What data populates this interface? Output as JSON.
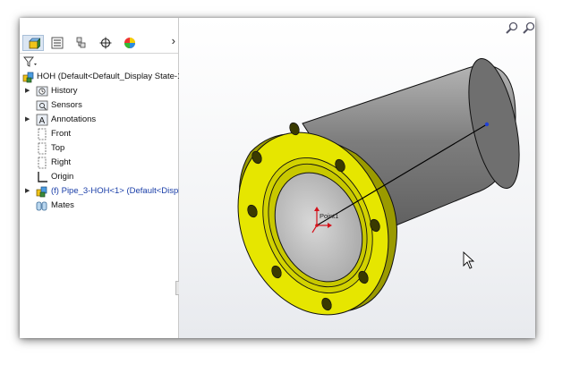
{
  "tabs": [
    {
      "icon": "feature-manager-icon",
      "active": true
    },
    {
      "icon": "property-manager-icon",
      "active": false
    },
    {
      "icon": "configuration-manager-icon",
      "active": false
    },
    {
      "icon": "dimxpert-manager-icon",
      "active": false
    },
    {
      "icon": "display-manager-icon",
      "active": false
    }
  ],
  "tabs_more": "›",
  "tree": {
    "root": "HOH  (Default<Default_Display State-1>",
    "items": [
      {
        "label": "History",
        "icon": "history-icon",
        "expandable": true
      },
      {
        "label": "Sensors",
        "icon": "sensors-icon",
        "expandable": false
      },
      {
        "label": "Annotations",
        "icon": "annotations-icon",
        "expandable": true
      },
      {
        "label": "Front",
        "icon": "plane-icon",
        "expandable": false
      },
      {
        "label": "Top",
        "icon": "plane-icon",
        "expandable": false
      },
      {
        "label": "Right",
        "icon": "plane-icon",
        "expandable": false
      },
      {
        "label": "Origin",
        "icon": "origin-icon",
        "expandable": false
      },
      {
        "label": "(f) Pipe_3-HOH<1> (Default<Display",
        "icon": "part-icon",
        "expandable": true,
        "highlight": true
      },
      {
        "label": "Mates",
        "icon": "mates-icon",
        "expandable": false
      }
    ]
  },
  "viewport": {
    "origin_label": "Point1",
    "colors": {
      "flange": "#e6e600",
      "pipe": "#8a8a8a",
      "edges": "#111111",
      "sketch_line": "#000000",
      "endpoint": "#1f3fd6",
      "origin": "#d4111a"
    }
  }
}
